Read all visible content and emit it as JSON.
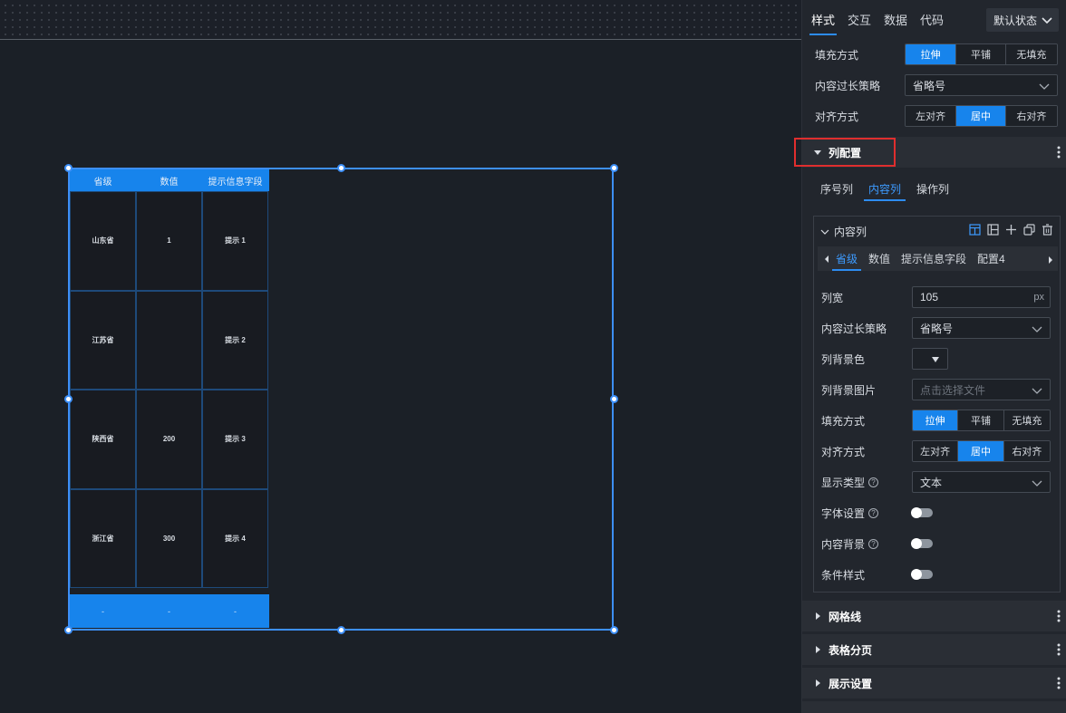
{
  "table": {
    "headers": [
      "省级",
      "数值",
      "提示信息字段"
    ],
    "rows": [
      [
        "山东省",
        "1",
        "提示 1"
      ],
      [
        "江苏省",
        "",
        "提示 2"
      ],
      [
        "陕西省",
        "200",
        "提示 3"
      ],
      [
        "浙江省",
        "300",
        "提示 4"
      ]
    ],
    "footer": [
      "-",
      "-",
      "-"
    ]
  },
  "panel": {
    "tabs": [
      "样式",
      "交互",
      "数据",
      "代码"
    ],
    "state_select": "默认状态",
    "fill_label": "填充方式",
    "fill_options": [
      "拉伸",
      "平铺",
      "无填充"
    ],
    "overflow_label": "内容过长策略",
    "overflow_value": "省略号",
    "align_label": "对齐方式",
    "align_options": [
      "左对齐",
      "居中",
      "右对齐"
    ],
    "section_column": "列配置",
    "sub_tabs": [
      "序号列",
      "内容列",
      "操作列"
    ],
    "content_col": {
      "title": "内容列",
      "fields": [
        "省级",
        "数值",
        "提示信息字段",
        "配置4"
      ],
      "width_label": "列宽",
      "width_value": "105",
      "width_unit": "px",
      "overflow_label": "内容过长策略",
      "overflow_value": "省略号",
      "bg_color_label": "列背景色",
      "bg_image_label": "列背景图片",
      "bg_image_placeholder": "点击选择文件",
      "fill_label": "填充方式",
      "fill_options": [
        "拉伸",
        "平铺",
        "无填充"
      ],
      "align_label": "对齐方式",
      "align_options": [
        "左对齐",
        "居中",
        "右对齐"
      ],
      "display_type_label": "显示类型",
      "display_type_value": "文本",
      "font_label": "字体设置",
      "content_bg_label": "内容背景",
      "cond_style_label": "条件样式",
      "help_glyph": "?"
    },
    "sections": [
      "网格线",
      "表格分页",
      "展示设置"
    ]
  },
  "colors": {
    "accent": "#1784ec",
    "highlight": "#e02e2e",
    "selection": "#3d8ff7"
  }
}
